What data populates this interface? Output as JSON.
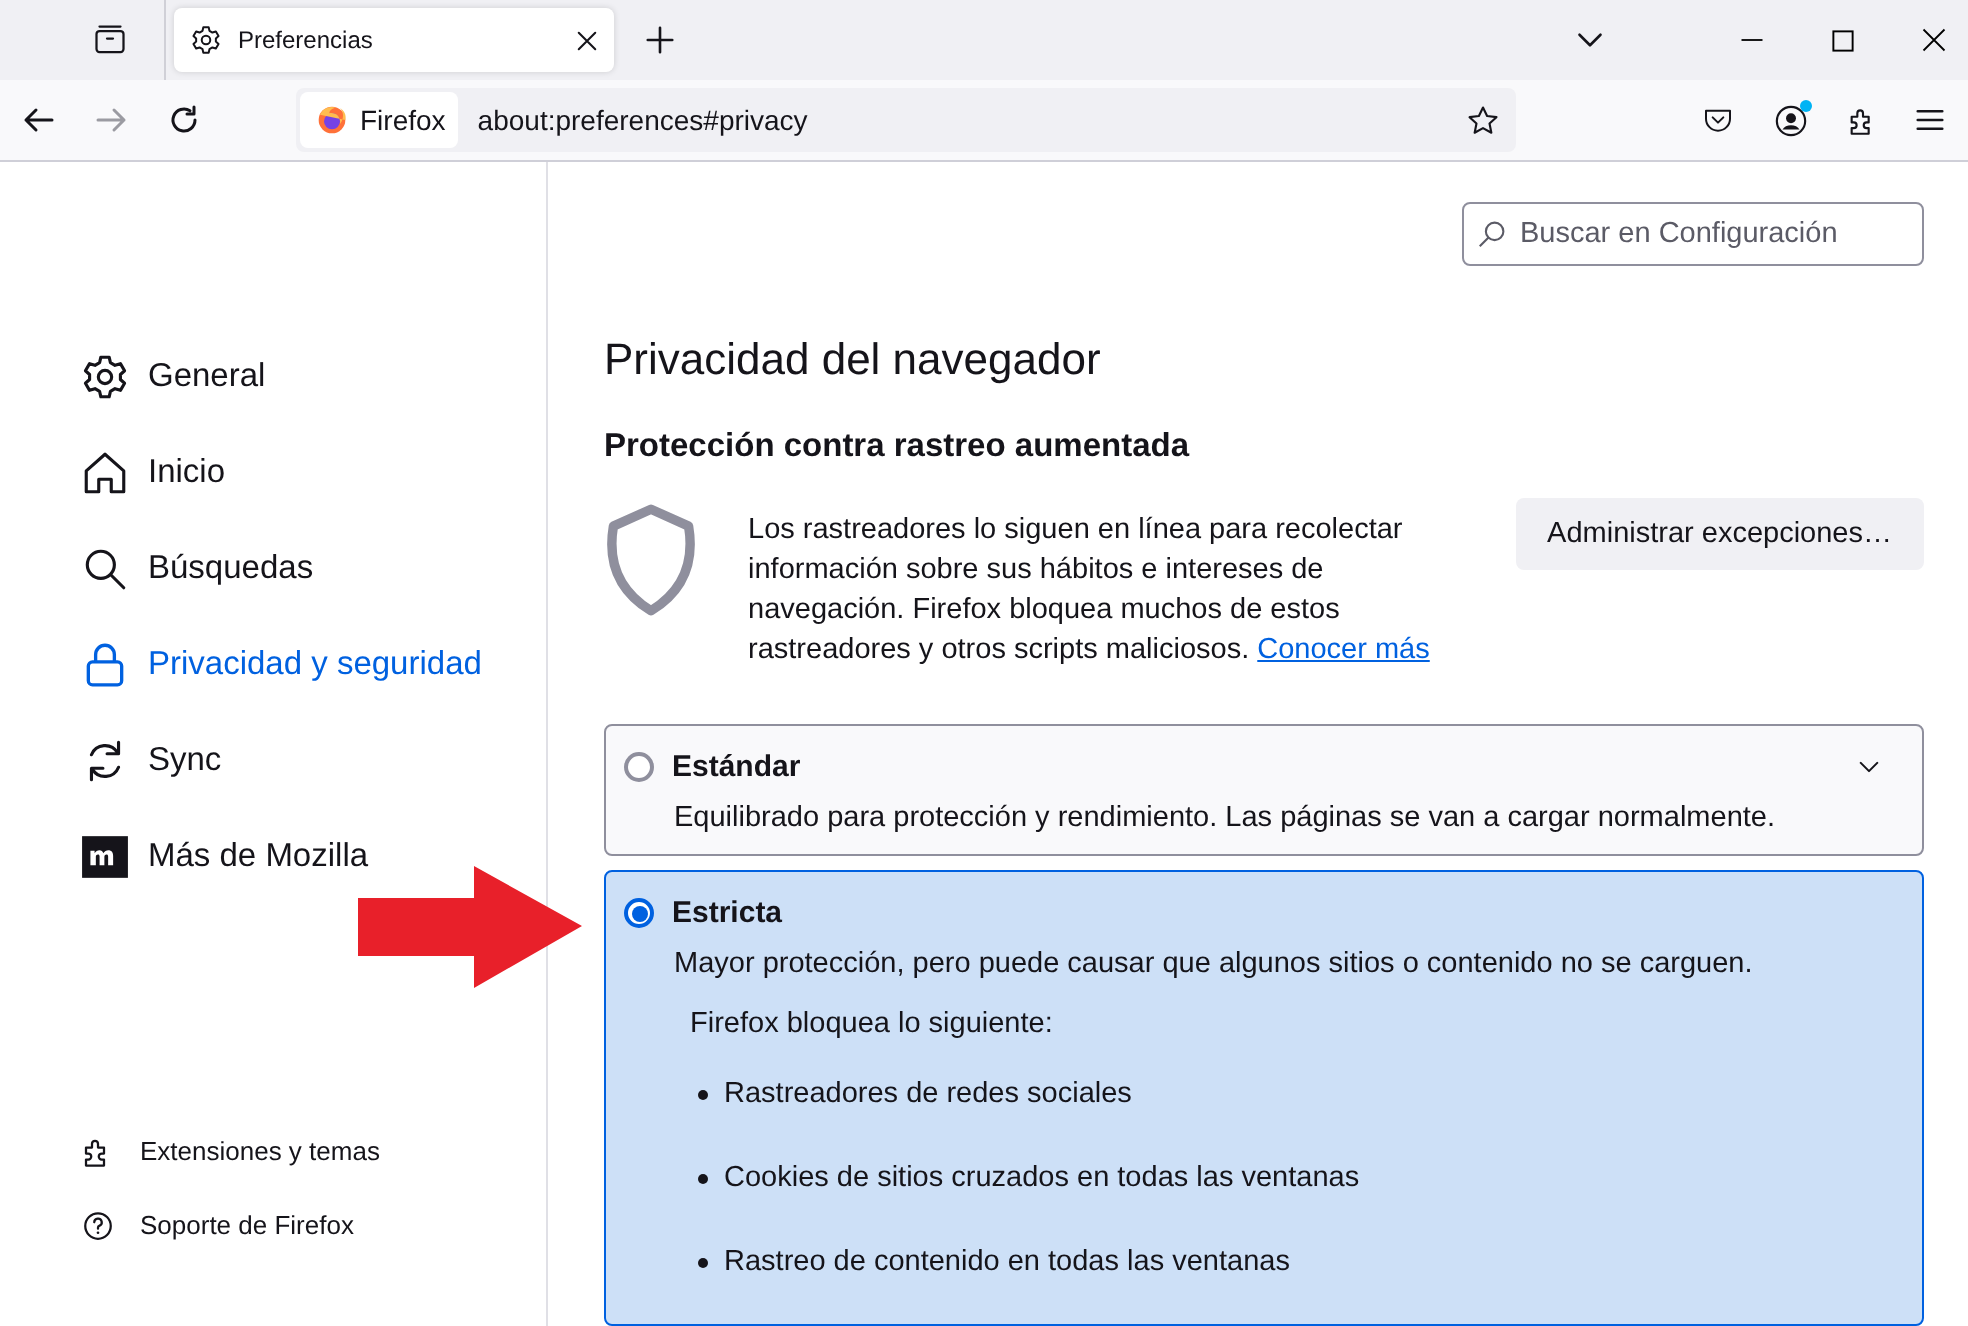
{
  "tabs": [
    {
      "title": "Preferencias",
      "selected": true
    }
  ],
  "address_bar": {
    "identity": "Firefox",
    "url": "about:preferences#privacy"
  },
  "toolbar": {
    "account_badge": true
  },
  "search": {
    "placeholder": "Buscar en Configuración"
  },
  "sidebar": {
    "items": [
      {
        "label": "General",
        "kind": "gear",
        "selected": false
      },
      {
        "label": "Inicio",
        "kind": "home",
        "selected": false
      },
      {
        "label": "Búsquedas",
        "kind": "search",
        "selected": false
      },
      {
        "label": "Privacidad y seguridad",
        "kind": "lock",
        "selected": true
      },
      {
        "label": "Sync",
        "kind": "sync",
        "selected": false
      },
      {
        "label": "Más de Mozilla",
        "kind": "mozilla",
        "selected": false
      }
    ],
    "footer_items": [
      {
        "label": "Extensiones y temas",
        "kind": "puzzle"
      },
      {
        "label": "Soporte de Firefox",
        "kind": "help"
      }
    ]
  },
  "page": {
    "title": "Privacidad del navegador",
    "section_title": "Protección contra rastreo aumentada",
    "description": "Los rastreadores lo siguen en línea para recolectar información sobre sus hábitos e intereses de navegación. Firefox bloquea muchos de estos rastreadores y otros scripts maliciosos.",
    "learn_more_link": "Conocer más",
    "exceptions_button": "Administrar excepciones…"
  },
  "options": [
    {
      "label": "Estándar",
      "description": "Equilibrado para protección y rendimiento. Las páginas se van a cargar normalmente.",
      "selected": false,
      "expanded": false
    },
    {
      "label": "Estricta",
      "description": "Mayor protección, pero puede causar que algunos sitios o contenido no se carguen.",
      "selected": true,
      "expanded": true,
      "blocked_heading": "Firefox bloquea lo siguiente:",
      "blocked_items": [
        "Rastreadores de redes sociales",
        "Cookies de sitios cruzados en todas las ventanas",
        "Rastreo de contenido en todas las ventanas"
      ]
    }
  ]
}
